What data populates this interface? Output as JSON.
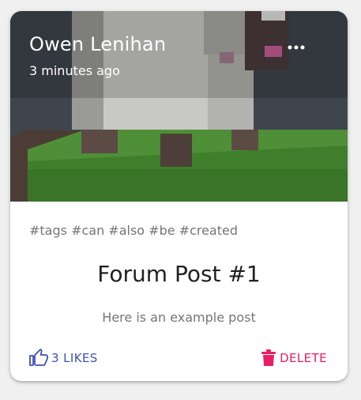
{
  "post": {
    "author": "Owen Lenihan",
    "time": "3 minutes ago",
    "tags": "#tags #can #also #be #created",
    "title": "Forum Post #1",
    "body": "Here is an example post"
  },
  "actions": {
    "likes_label": "3 LIKES",
    "delete_label": "DELETE"
  },
  "icons": {
    "more": "more-horizontal-icon",
    "like": "thumb-up-icon",
    "delete": "trash-icon"
  },
  "colors": {
    "primary": "#3f51b5",
    "secondary": "#e91e63"
  }
}
